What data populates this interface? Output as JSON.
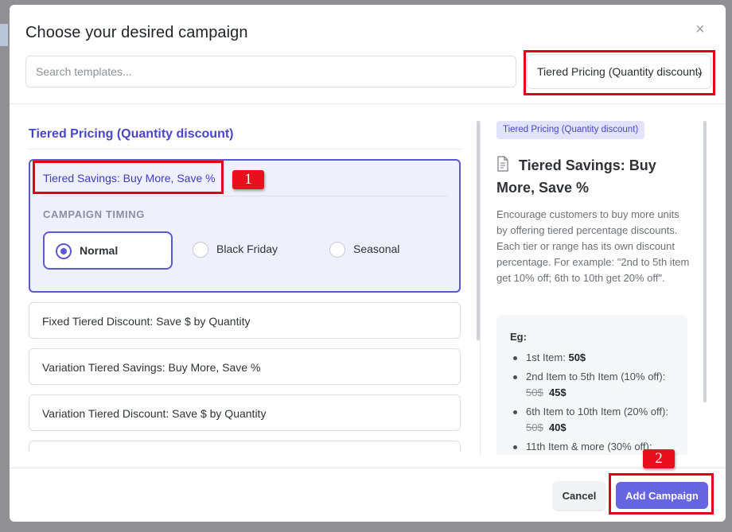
{
  "modal": {
    "title": "Choose your desired campaign",
    "close_label": "×"
  },
  "search": {
    "placeholder": "Search templates..."
  },
  "category_select": {
    "selected": "Tiered Pricing (Quantity discount)"
  },
  "left": {
    "group_title": "Tiered Pricing (Quantity discount)",
    "templates": [
      {
        "label": "Tiered Savings: Buy More, Save %",
        "selected": true
      },
      {
        "label": "Fixed Tiered Discount: Save $ by Quantity"
      },
      {
        "label": "Variation Tiered Savings: Buy More, Save %"
      },
      {
        "label": "Variation Tiered Discount: Save $ by Quantity"
      },
      {
        "label": ""
      }
    ],
    "timing": {
      "label": "CAMPAIGN TIMING",
      "options": [
        "Normal",
        "Black Friday",
        "Seasonal"
      ],
      "selected": "Normal"
    }
  },
  "detail": {
    "tag": "Tiered Pricing (Quantity discount)",
    "title": "Tiered Savings: Buy More, Save %",
    "description": "Encourage customers to buy more units by offering tiered percentage discounts. Each tier or range has its own discount percentage. For example: \"2nd to 5th item get 10% off; 6th to 10th get 20% off\".",
    "example_label": "Eg:",
    "examples": [
      {
        "text": "1st Item: ",
        "old": "",
        "new": "50$"
      },
      {
        "text": "2nd Item to 5th Item (10% off): ",
        "old": "50$",
        "new": "45$"
      },
      {
        "text": "6th Item to 10th Item (20% off): ",
        "old": "50$",
        "new": "40$"
      },
      {
        "text": "11th Item & more (30% off):",
        "old": "",
        "new": ""
      }
    ]
  },
  "footer": {
    "cancel_label": "Cancel",
    "add_label": "Add Campaign"
  },
  "annotations": {
    "badge_1": "1",
    "badge_2": "2"
  },
  "colors": {
    "accent": "#5b58d6",
    "primary_button": "#6565e0",
    "annotation_red": "#e0001a"
  }
}
